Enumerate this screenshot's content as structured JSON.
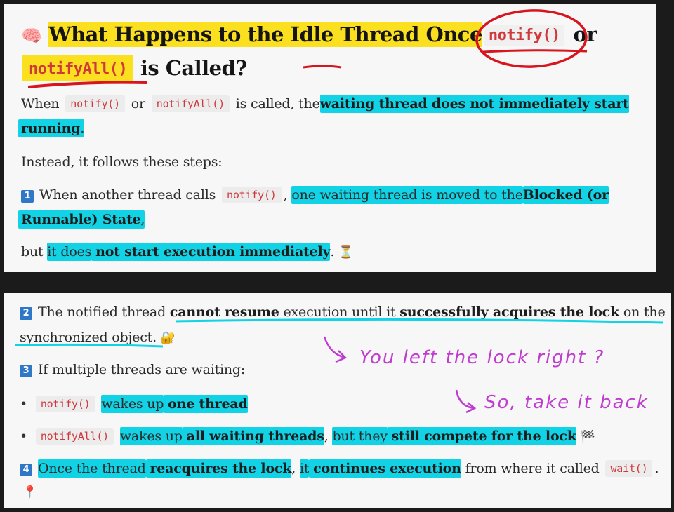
{
  "title": {
    "emoji": "🧠",
    "text_before": "What Happens to the Idle Thread Once",
    "code_notify": "notify()",
    "or": "or",
    "code_notify_all": "notifyAll()",
    "text_after": "is Called?"
  },
  "intro": {
    "when": "When",
    "code_notify": "notify()",
    "or": "or",
    "code_notify_all": "notifyAll()",
    "is_called": "is called, the",
    "highlight_1": "waiting thread does not immediately start",
    "highlight_2": "running",
    "period": "."
  },
  "instead": "Instead, it follows these steps:",
  "step1": {
    "number": "1",
    "text_a": "When another thread calls",
    "code": "notify()",
    "comma": ",",
    "highlight": "one waiting thread is moved to the",
    "bold_1": "Blocked (or",
    "bold_2": "Runnable) State",
    "comma2": ","
  },
  "step1_cont": {
    "text_a": "but",
    "highlight_a": "it does",
    "bold": "not start execution immediately",
    "period": ".",
    "emoji": "⏳"
  },
  "step2": {
    "number": "2",
    "text_a": "The notified thread",
    "bold_1": "cannot resume",
    "text_b": "execution until it",
    "bold_2": "successfully acquires the lock",
    "text_c": "on the",
    "text_d": "synchronized object",
    "period": ".",
    "emoji": "🔐"
  },
  "step3": {
    "number": "3",
    "text": "If multiple threads are waiting:"
  },
  "bullet1": {
    "bullet": "•",
    "code": "notify()",
    "text_a": "wakes up",
    "bold": "one thread"
  },
  "bullet2": {
    "bullet": "•",
    "code": "notifyAll()",
    "text_a": "wakes up",
    "bold_1": "all waiting threads",
    "comma": ",",
    "text_b": "but they",
    "bold_2": "still compete for the lock",
    "emoji": "🏁"
  },
  "step4": {
    "number": "4",
    "text_a": "Once the thread",
    "bold_1": "reacquires the lock",
    "comma": ",",
    "text_b": "it",
    "bold_2": "continues execution",
    "text_c": "from where it called",
    "code": "wait()",
    "period": ".",
    "emoji": "📍"
  },
  "handwriting": {
    "line1": "You left the lock right ?",
    "line2": "So, take it back"
  },
  "colors": {
    "highlight_yellow": "#fbe01f",
    "highlight_cyan": "#12d3e6",
    "code_red": "#d0383b",
    "ink_red": "#d8151f",
    "ink_magenta": "#c03cd0",
    "step_badge": "#2f78c8"
  }
}
